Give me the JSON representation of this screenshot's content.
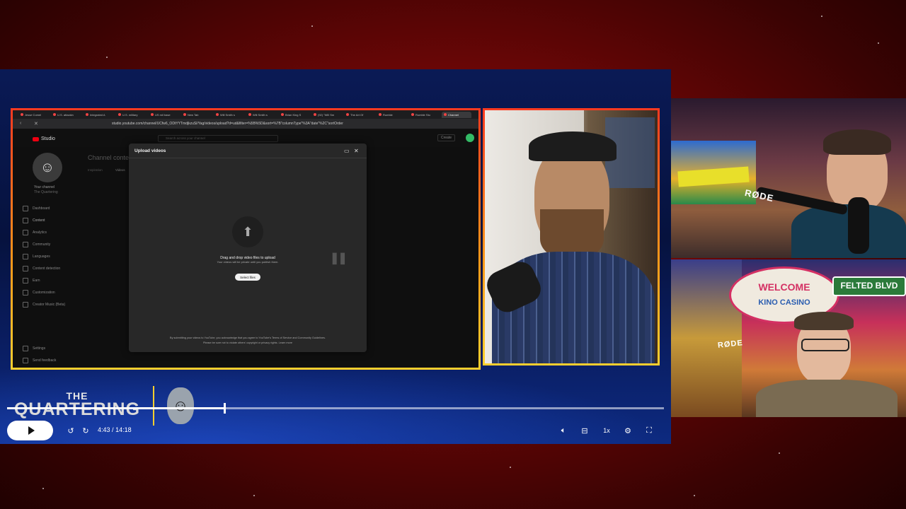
{
  "browser": {
    "tabs": [
      {
        "label": "Jesse Comel"
      },
      {
        "label": "U.S. attackin"
      },
      {
        "label": "Integrated A"
      },
      {
        "label": "U.S. military"
      },
      {
        "label": "US mil base"
      },
      {
        "label": "New Tab"
      },
      {
        "label": "Will Smith s"
      },
      {
        "label": "Will Smith s"
      },
      {
        "label": "Brian King S"
      },
      {
        "label": "(92) \"Will Sm"
      },
      {
        "label": "The Art Of"
      },
      {
        "label": "Rumble"
      },
      {
        "label": "Rumble Stu"
      },
      {
        "label": "Channel"
      }
    ],
    "url": "studio.youtube.com/channel/UCfw6_ODtYYTmdjkzuSl/Yag/videos/upload?d=ud&filter=%5B%5D&sort=%7B\"columnType\"%3A\"date\"%2C\"sortOrder"
  },
  "studio": {
    "logo_label": "Studio",
    "search_placeholder": "Search across your channel",
    "channel_heading": "Channel content",
    "channel_name": "Your channel",
    "channel_handle": "The Quartering",
    "subtabs": [
      "Inspiration",
      "Videos"
    ],
    "nav": [
      "Dashboard",
      "Content",
      "Analytics",
      "Community",
      "Languages",
      "Content detection",
      "Earn",
      "Customization",
      "Creator Music (Beta)"
    ],
    "nav_bottom": [
      "Settings",
      "Send feedback"
    ],
    "create_label": "Create"
  },
  "modal": {
    "title": "Upload videos",
    "drop_main": "Drag and drop video files to upload",
    "drop_sub": "Your videos will be private until you publish them.",
    "select_button": "Select files",
    "terms_line1": "By submitting your videos to YouTube, you acknowledge that you agree to YouTube's Terms of Service and Community Guidelines.",
    "terms_line2": "Please be sure not to violate others' copyright or privacy rights. Learn more"
  },
  "cameras": {
    "cam2_sign": "RØDE",
    "cam3_sign_welcome": "WELCOME",
    "cam3_sign_casino": "KINO CASINO",
    "cam3_sign_felted": "FELTED BLVD",
    "cam3_rode": "RØDE"
  },
  "brand": {
    "the": "THE",
    "name": "QUARTERING"
  },
  "player": {
    "current_time": "4:43",
    "separator": "/",
    "duration": "14:18",
    "progress_fraction": 0.33,
    "speed": "1x"
  },
  "colors": {
    "frame_top": "#ff3a1f",
    "frame_bottom": "#ffcf2e",
    "stage_blue": "#0a1a55",
    "background_red": "#8a0a0a"
  }
}
